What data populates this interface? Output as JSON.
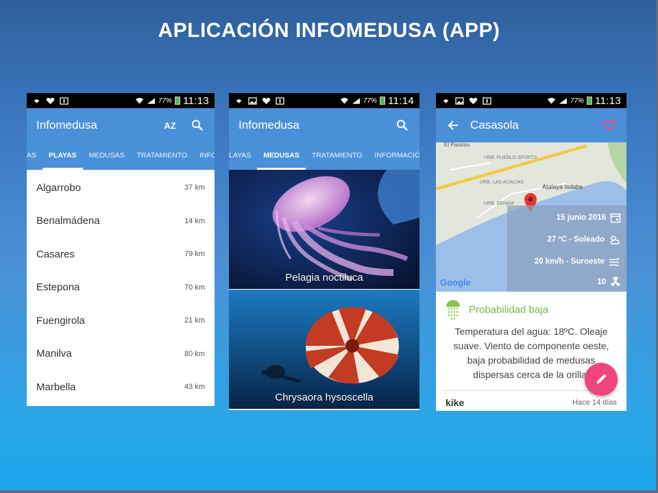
{
  "slide": {
    "title": "APLICACIÓN INFOMEDUSA (APP)"
  },
  "status": {
    "battery_pct": "77%",
    "time_1": "11:13",
    "time_2": "11:14",
    "time_3": "11:13"
  },
  "screen1": {
    "app_title": "Infomedusa",
    "sort_icon_label": "AZ",
    "tabs": [
      "AS",
      "PLAYAS",
      "MEDUSAS",
      "TRATAMIENTO",
      "INFORMA"
    ],
    "active_tab": 1,
    "beaches": [
      {
        "name": "Algarrobo",
        "distance": "37 km"
      },
      {
        "name": "Benalmádena",
        "distance": "14 km"
      },
      {
        "name": "Casares",
        "distance": "79 km"
      },
      {
        "name": "Estepona",
        "distance": "70 km"
      },
      {
        "name": "Fuengirola",
        "distance": "21 km"
      },
      {
        "name": "Manilva",
        "distance": "80 km"
      },
      {
        "name": "Marbella",
        "distance": "43 km"
      }
    ]
  },
  "screen2": {
    "app_title": "Infomedusa",
    "tabs": [
      "LAYAS",
      "MEDUSAS",
      "TRATAMIENTO",
      "INFORMACIÓN"
    ],
    "active_tab": 1,
    "jellyfish": [
      {
        "name": "Pelagia noctiluca"
      },
      {
        "name": "Chrysaora hysoscella"
      }
    ]
  },
  "screen3": {
    "title": "Casasola",
    "map": {
      "labels": [
        "El Paraíso",
        "URB. PUEBLO SPORTS",
        "URB. LAS ACACIAS",
        "Atalaya Isdabe",
        "URB. BENAM"
      ],
      "google": "Google"
    },
    "conditions": {
      "date": "15 junio 2016",
      "weather": "27 ºC - Soleado",
      "wind": "20 km/h - Suroeste",
      "uv": "10"
    },
    "probability": {
      "title": "Probabilidad baja",
      "text": "Temperatura del agua: 18ºC. Oleaje suave. Viento de componente oeste, baja probabilidad de medusas dispersas cerca de la orilla."
    },
    "comment": {
      "user": "kike",
      "time": "Hace 14 días"
    }
  },
  "colors": {
    "appbar": "#4a90d9",
    "fab": "#f0447c",
    "probability": "#7ab648"
  }
}
